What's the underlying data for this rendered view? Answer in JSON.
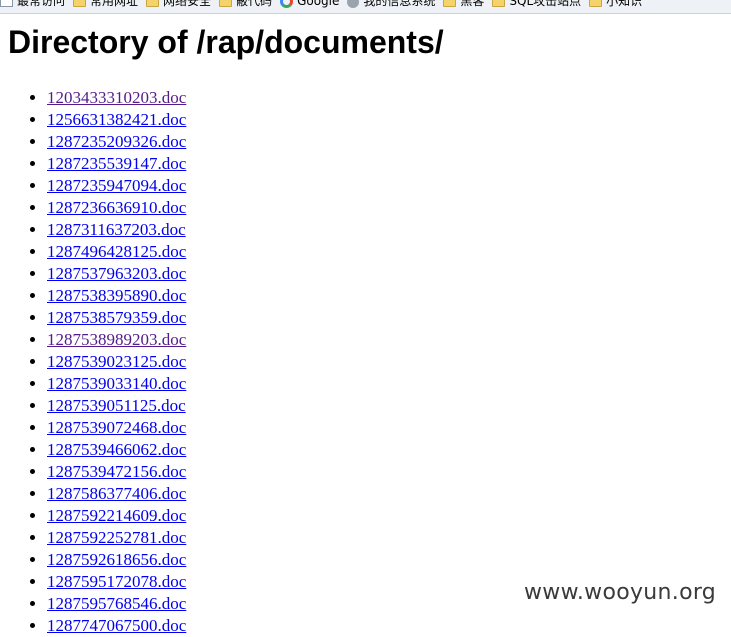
{
  "bookmarks": [
    {
      "label": "最常访问",
      "icon": "page-icon"
    },
    {
      "label": "常用网址",
      "icon": "folder-icon"
    },
    {
      "label": "网络安全",
      "icon": "folder-icon"
    },
    {
      "label": "蔽代码",
      "icon": "folder-icon"
    },
    {
      "label": "Google",
      "icon": "google-icon"
    },
    {
      "label": "我的信息系统",
      "icon": "globe-icon"
    },
    {
      "label": "黑客",
      "icon": "folder-icon"
    },
    {
      "label": "SQL攻击站点",
      "icon": "folder-icon"
    },
    {
      "label": "小知识",
      "icon": "folder-icon"
    }
  ],
  "page": {
    "title": "Directory of /rap/documents/"
  },
  "files": [
    {
      "name": "1203433310203.doc",
      "visited": true
    },
    {
      "name": "1256631382421.doc",
      "visited": false
    },
    {
      "name": "1287235209326.doc",
      "visited": false
    },
    {
      "name": "1287235539147.doc",
      "visited": false
    },
    {
      "name": "1287235947094.doc",
      "visited": false
    },
    {
      "name": "1287236636910.doc",
      "visited": false
    },
    {
      "name": "1287311637203.doc",
      "visited": false
    },
    {
      "name": "1287496428125.doc",
      "visited": false
    },
    {
      "name": "1287537963203.doc",
      "visited": false
    },
    {
      "name": "1287538395890.doc",
      "visited": false
    },
    {
      "name": "1287538579359.doc",
      "visited": false
    },
    {
      "name": "1287538989203.doc",
      "visited": true
    },
    {
      "name": "1287539023125.doc",
      "visited": false
    },
    {
      "name": "1287539033140.doc",
      "visited": false
    },
    {
      "name": "1287539051125.doc",
      "visited": false
    },
    {
      "name": "1287539072468.doc",
      "visited": false
    },
    {
      "name": "1287539466062.doc",
      "visited": false
    },
    {
      "name": "1287539472156.doc",
      "visited": false
    },
    {
      "name": "1287586377406.doc",
      "visited": false
    },
    {
      "name": "1287592214609.doc",
      "visited": false
    },
    {
      "name": "1287592252781.doc",
      "visited": false
    },
    {
      "name": "1287592618656.doc",
      "visited": false
    },
    {
      "name": "1287595172078.doc",
      "visited": false
    },
    {
      "name": "1287595768546.doc",
      "visited": false
    },
    {
      "name": "1287747067500.doc",
      "visited": false
    }
  ],
  "watermark": "www.wooyun.org",
  "colors": {
    "link": "#0000ee",
    "visited_link": "#551a8b"
  }
}
